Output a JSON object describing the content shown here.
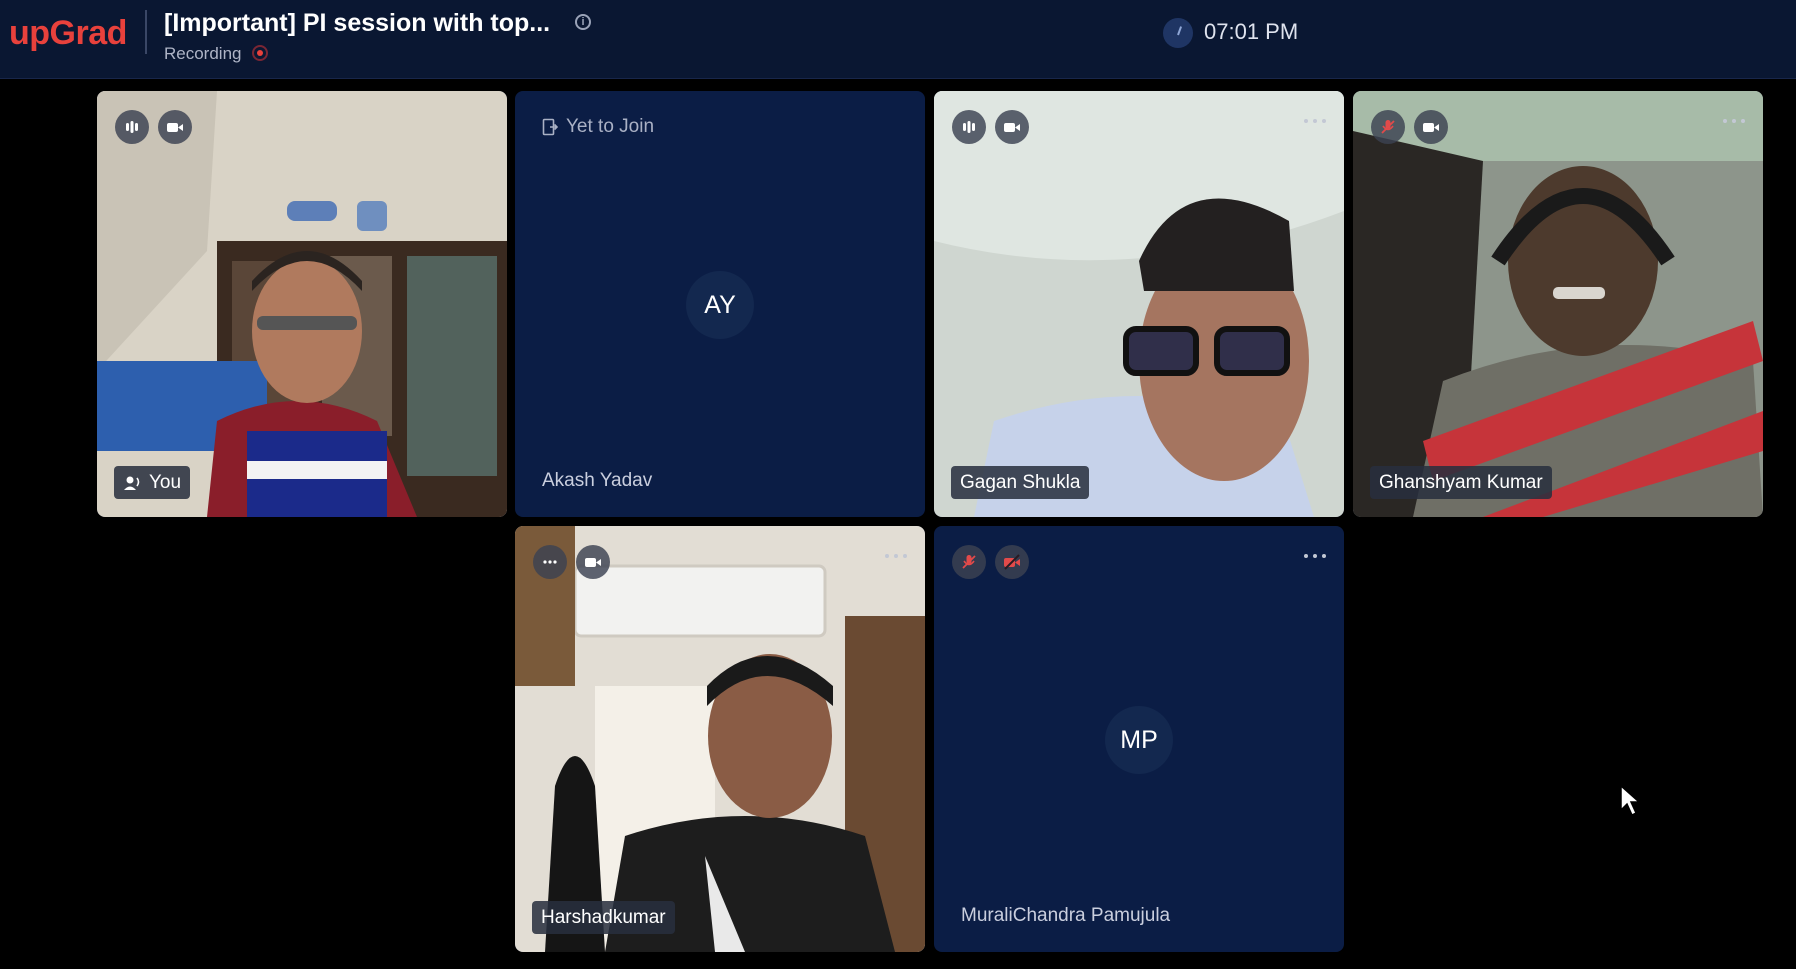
{
  "app": {
    "logo": "upGrad",
    "meeting_title": "[Important] PI session with top...",
    "recording_label": "Recording",
    "clock": "07:01 PM"
  },
  "colors": {
    "topbar": "#0a1732",
    "tile_bg": "#0b1d45",
    "brand": "#e8413c"
  },
  "participants": [
    {
      "name": "You",
      "status": "video",
      "mic": "active-speaker",
      "camera": "on",
      "badge_icon": "speaker-icon"
    },
    {
      "name": "Akash Yadav",
      "status": "Yet to Join",
      "initials": "AY"
    },
    {
      "name": "Gagan Shukla",
      "status": "video",
      "mic": "on",
      "camera": "on"
    },
    {
      "name": "Ghanshyam Kumar",
      "status": "video",
      "mic": "muted",
      "camera": "on"
    },
    {
      "name": "Harshadkumar",
      "status": "video",
      "mic": "connecting",
      "camera": "on"
    },
    {
      "name": "MuraliChandra Pamujula",
      "status": "no-video",
      "mic": "muted",
      "camera": "off",
      "initials": "MP"
    }
  ]
}
